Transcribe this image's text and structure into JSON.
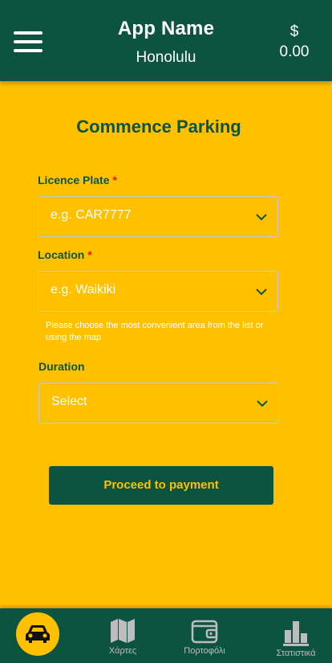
{
  "header": {
    "app_name": "App Name",
    "city": "Honolulu",
    "currency": "$",
    "balance": "0.00"
  },
  "form": {
    "title": "Commence Parking",
    "licence_plate": {
      "label": "Licence Plate",
      "required_mark": "*",
      "placeholder": "e.g. CAR7777"
    },
    "location": {
      "label": "Location",
      "required_mark": "*",
      "placeholder": "e.g. Waikiki",
      "hint": "Please choose the most convenient area from the list or using the map"
    },
    "duration": {
      "label": "Duration",
      "placeholder": "Select"
    },
    "submit_label": "Proceed to payment"
  },
  "bottom_nav": {
    "items": [
      {
        "icon": "car-icon",
        "label": ""
      },
      {
        "icon": "map-icon",
        "label": "Χάρτες"
      },
      {
        "icon": "wallet-icon",
        "label": "Πορτοφόλι"
      },
      {
        "icon": "bar-chart-icon",
        "label": "Στατιστικά"
      }
    ]
  },
  "colors": {
    "primary_green": "#0C5440",
    "accent_yellow": "#FFC000",
    "required_red": "#E0141E"
  }
}
